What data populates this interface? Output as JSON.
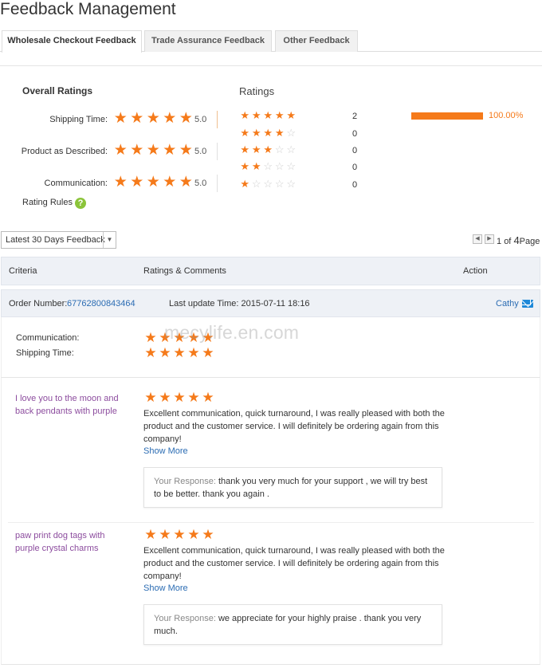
{
  "page": {
    "title": "Feedback Management"
  },
  "tabs": [
    {
      "label": "Wholesale Checkout Feedback",
      "active": true
    },
    {
      "label": "Trade Assurance Feedback",
      "active": false
    },
    {
      "label": "Other Feedback",
      "active": false
    }
  ],
  "overall": {
    "title": "Overall Ratings",
    "items": [
      {
        "label": "Shipping Time:",
        "stars": 5,
        "score": "5.0"
      },
      {
        "label": "Product as Described:",
        "stars": 5,
        "score": "5.0"
      },
      {
        "label": "Communication:",
        "stars": 5,
        "score": "5.0"
      }
    ],
    "rules_label": "Rating Rules",
    "rules_icon": "question-icon"
  },
  "distribution": {
    "title": "Ratings",
    "rows": [
      {
        "stars": 5,
        "count": "2",
        "percent": "100.00%",
        "fraction": 1.0
      },
      {
        "stars": 4,
        "count": "0"
      },
      {
        "stars": 3,
        "count": "0"
      },
      {
        "stars": 2,
        "count": "0"
      },
      {
        "stars": 1,
        "count": "0"
      }
    ]
  },
  "filter": {
    "selected": "Latest 30 Days Feedback"
  },
  "pager": {
    "current": "1",
    "of_label": "of",
    "total": "4",
    "page_label": "Page"
  },
  "table": {
    "headers": [
      "Criteria",
      "Ratings & Comments",
      "Action"
    ]
  },
  "order": {
    "number_label": "Order Number:",
    "number": "67762800843464",
    "update_label": "Last update Time:",
    "update_time": "2015-07-11 18:16",
    "buyer": "Cathy",
    "buyer_icon": "mail-icon",
    "ratings": [
      {
        "label": "Communication:",
        "stars": 5
      },
      {
        "label": "Shipping Time:",
        "stars": 5
      }
    ]
  },
  "feedback_items": [
    {
      "product": "I love you to the moon and back pendants with purple",
      "stars": 5,
      "comment": "Excellent communication, quick turnaround, I was really pleased with both the product and the customer service. I will definitely be ordering again from this company!",
      "show_more": "Show More",
      "response_label": "Your Response:",
      "response": "thank you very much for your support , we will try best to be better. thank you again ."
    },
    {
      "product": "paw print dog tags with purple crystal charms",
      "stars": 5,
      "comment": "Excellent communication, quick turnaround, I was really pleased with both the product and the customer service. I will definitely be ordering again from this company!",
      "show_more": "Show More",
      "response_label": "Your Response:",
      "response": "we appreciate for your highly praise . thank you very much."
    }
  ],
  "watermark": "mecylife.en.com",
  "colors": {
    "star": "#f57a1a",
    "star_empty": "#cfcfcf",
    "link": "#2b6cb3",
    "product": "#8c4c9e",
    "accent_green": "#8bc43a"
  }
}
